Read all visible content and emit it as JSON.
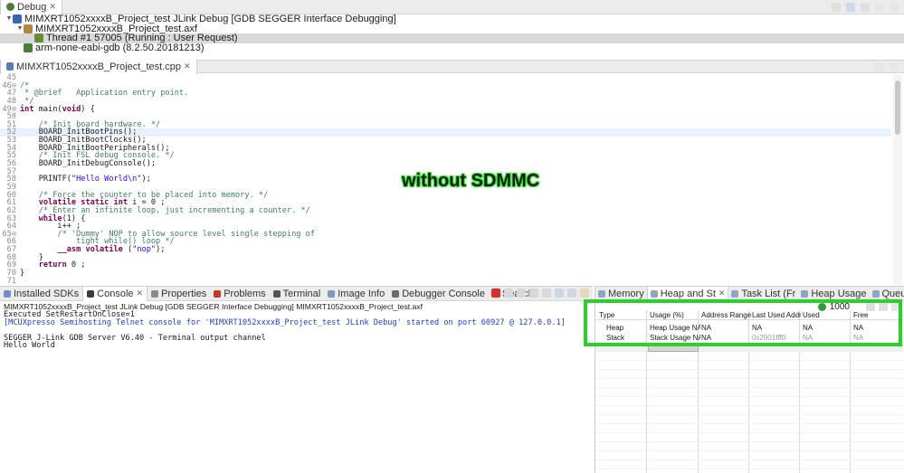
{
  "debug": {
    "tab_label": "Debug",
    "tree": [
      {
        "text": "MIMXRT1052xxxxB_Project_test JLink Debug [GDB SEGGER Interface Debugging]",
        "level": 0
      },
      {
        "text": "MIMXRT1052xxxxB_Project_test.axf",
        "level": 1
      },
      {
        "text": "Thread #1 57005 (Running : User Request)",
        "level": 2
      },
      {
        "text": "arm-none-eabi-gdb (8.2.50.20181213)",
        "level": 1
      }
    ]
  },
  "editor": {
    "tab_label": "MIMXRT1052xxxxB_Project_test.cpp",
    "lines": [
      {
        "n": "45",
        "t": ""
      },
      {
        "n": "46⊖",
        "t": "/*"
      },
      {
        "n": "47",
        "t": " * @brief   Application entry point."
      },
      {
        "n": "48",
        "t": " */"
      },
      {
        "n": "49⊖",
        "t": "int main(void) {"
      },
      {
        "n": "50",
        "t": ""
      },
      {
        "n": "51",
        "t": "    /* Init board hardware. */"
      },
      {
        "n": "52",
        "t": "    BOARD_InitBootPins();"
      },
      {
        "n": "53",
        "t": "    BOARD_InitBootClocks();"
      },
      {
        "n": "54",
        "t": "    BOARD_InitBootPeripherals();"
      },
      {
        "n": "55",
        "t": "    /* Init FSL debug console. */"
      },
      {
        "n": "56",
        "t": "    BOARD_InitDebugConsole();"
      },
      {
        "n": "57",
        "t": ""
      },
      {
        "n": "58",
        "t": "    PRINTF(\"Hello World\\n\");"
      },
      {
        "n": "59",
        "t": ""
      },
      {
        "n": "60",
        "t": "    /* Force the counter to be placed into memory. */"
      },
      {
        "n": "61",
        "t": "    volatile static int i = 0 ;"
      },
      {
        "n": "62",
        "t": "    /* Enter an infinite loop, just incrementing a counter. */"
      },
      {
        "n": "63",
        "t": "    while(1) {"
      },
      {
        "n": "64",
        "t": "        i++ ;"
      },
      {
        "n": "65⊖",
        "t": "        /* 'Dummy' NOP to allow source level single stepping of"
      },
      {
        "n": "66",
        "t": "            tight while() loop */"
      },
      {
        "n": "67",
        "t": "        __asm volatile (\"nop\");"
      },
      {
        "n": "68",
        "t": "    }"
      },
      {
        "n": "69",
        "t": "    return 0 ;"
      },
      {
        "n": "70",
        "t": "}"
      },
      {
        "n": "71",
        "t": ""
      }
    ]
  },
  "overlay_text": "without SDMMC",
  "bottom_tabs": [
    {
      "label": "Installed SDKs",
      "active": false
    },
    {
      "label": "Console",
      "active": true
    },
    {
      "label": "Properties",
      "active": false
    },
    {
      "label": "Problems",
      "active": false
    },
    {
      "label": "Terminal",
      "active": false
    },
    {
      "label": "Image Info",
      "active": false
    },
    {
      "label": "Debugger Console",
      "active": false
    },
    {
      "label": "Search",
      "active": false
    }
  ],
  "console": {
    "title": "MIMXRT1052xxxxB_Project_test JLink Debug [GDB SEGGER Interface Debugging] MIMXRT1052xxxxB_Project_test.axf",
    "lines": [
      {
        "text": "Executed SetRestartOnClose=1",
        "color": "#1a1a1a"
      },
      {
        "text": "[MCUXpresso Semihosting Telnet console for 'MIMXRT1052xxxxB_Project_test JLink Debug' started on port 60927 @ 127.0.0.1]",
        "color": "#1f3fcf"
      },
      {
        "text": "",
        "color": "#1a1a1a"
      },
      {
        "text": "SEGGER J-Link GDB Server V6.40 - Terminal output channel",
        "color": "#1a1a1a"
      },
      {
        "text": "Hello World",
        "color": "#1a1a1a"
      }
    ]
  },
  "right_tabs": [
    {
      "label": "Memory",
      "active": false
    },
    {
      "label": "Heap and St",
      "active": true
    },
    {
      "label": "Task List (Fr",
      "active": false
    },
    {
      "label": "Heap Usage",
      "active": false
    },
    {
      "label": "Queue List (",
      "active": false
    }
  ],
  "heap": {
    "refresh_value": "1000",
    "columns": [
      "Type",
      "Usage (%)",
      "Address Range",
      "Last Used Addres",
      "Used",
      "Free"
    ],
    "rows": [
      {
        "cells": [
          "Heap",
          "Heap Usage NA",
          "NA",
          "NA",
          "NA",
          "NA"
        ],
        "gray": [
          false,
          false,
          false,
          false,
          false,
          false
        ]
      },
      {
        "cells": [
          "Stack",
          "Stack Usage NA",
          "NA",
          "0x2001fff0",
          "NA",
          "NA"
        ],
        "gray": [
          false,
          false,
          false,
          true,
          true,
          true
        ]
      }
    ]
  },
  "colors": {
    "highlight": "#2bd12b",
    "selection": "#d9d9d9"
  }
}
